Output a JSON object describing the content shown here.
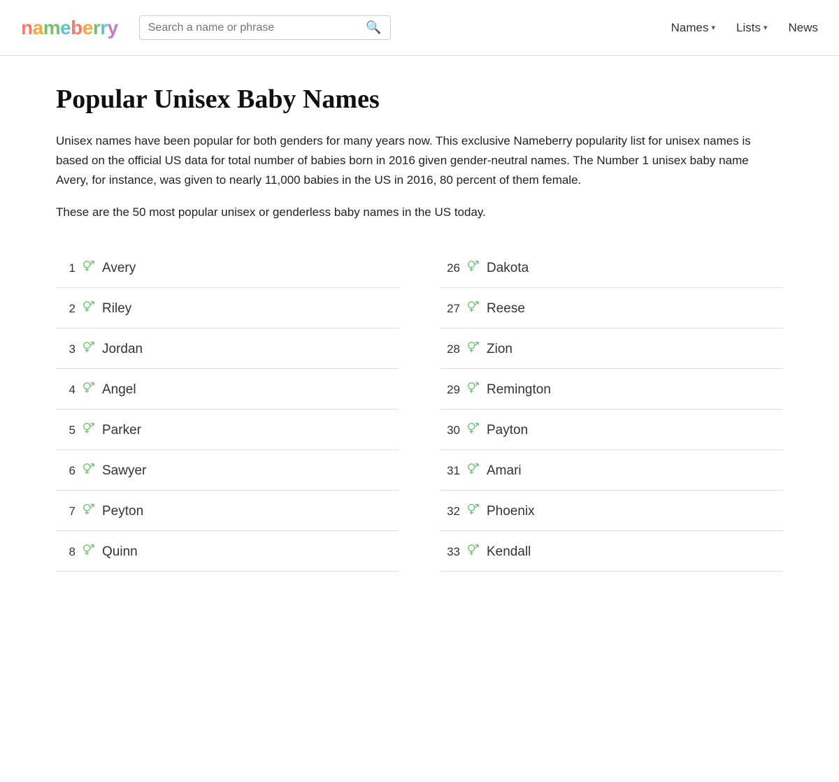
{
  "header": {
    "logo": "nameberry",
    "search_placeholder": "Search a name or phrase",
    "nav_items": [
      {
        "label": "Names",
        "has_dropdown": true
      },
      {
        "label": "Lists",
        "has_dropdown": true
      },
      {
        "label": "News",
        "has_dropdown": false
      }
    ]
  },
  "page": {
    "title": "Popular Unisex Baby Names",
    "intro1": "Unisex names have been popular for both genders for many years now. This exclusive Nameberry popularity list for unisex names is based on the official US data for total number of babies born in 2016 given gender-neutral names. The Number 1 unisex baby name Avery, for instance, was given to nearly 11,000 babies in the US in 2016, 80 percent of them female.",
    "intro2": "These are the 50 most popular unisex or genderless baby names in the US today."
  },
  "names_left": [
    {
      "rank": 1,
      "name": "Avery"
    },
    {
      "rank": 2,
      "name": "Riley"
    },
    {
      "rank": 3,
      "name": "Jordan"
    },
    {
      "rank": 4,
      "name": "Angel"
    },
    {
      "rank": 5,
      "name": "Parker"
    },
    {
      "rank": 6,
      "name": "Sawyer"
    },
    {
      "rank": 7,
      "name": "Peyton"
    },
    {
      "rank": 8,
      "name": "Quinn"
    }
  ],
  "names_right": [
    {
      "rank": 26,
      "name": "Dakota"
    },
    {
      "rank": 27,
      "name": "Reese"
    },
    {
      "rank": 28,
      "name": "Zion"
    },
    {
      "rank": 29,
      "name": "Remington"
    },
    {
      "rank": 30,
      "name": "Payton"
    },
    {
      "rank": 31,
      "name": "Amari"
    },
    {
      "rank": 32,
      "name": "Phoenix"
    },
    {
      "rank": 33,
      "name": "Kendall"
    }
  ],
  "gender_symbol": "⚥"
}
